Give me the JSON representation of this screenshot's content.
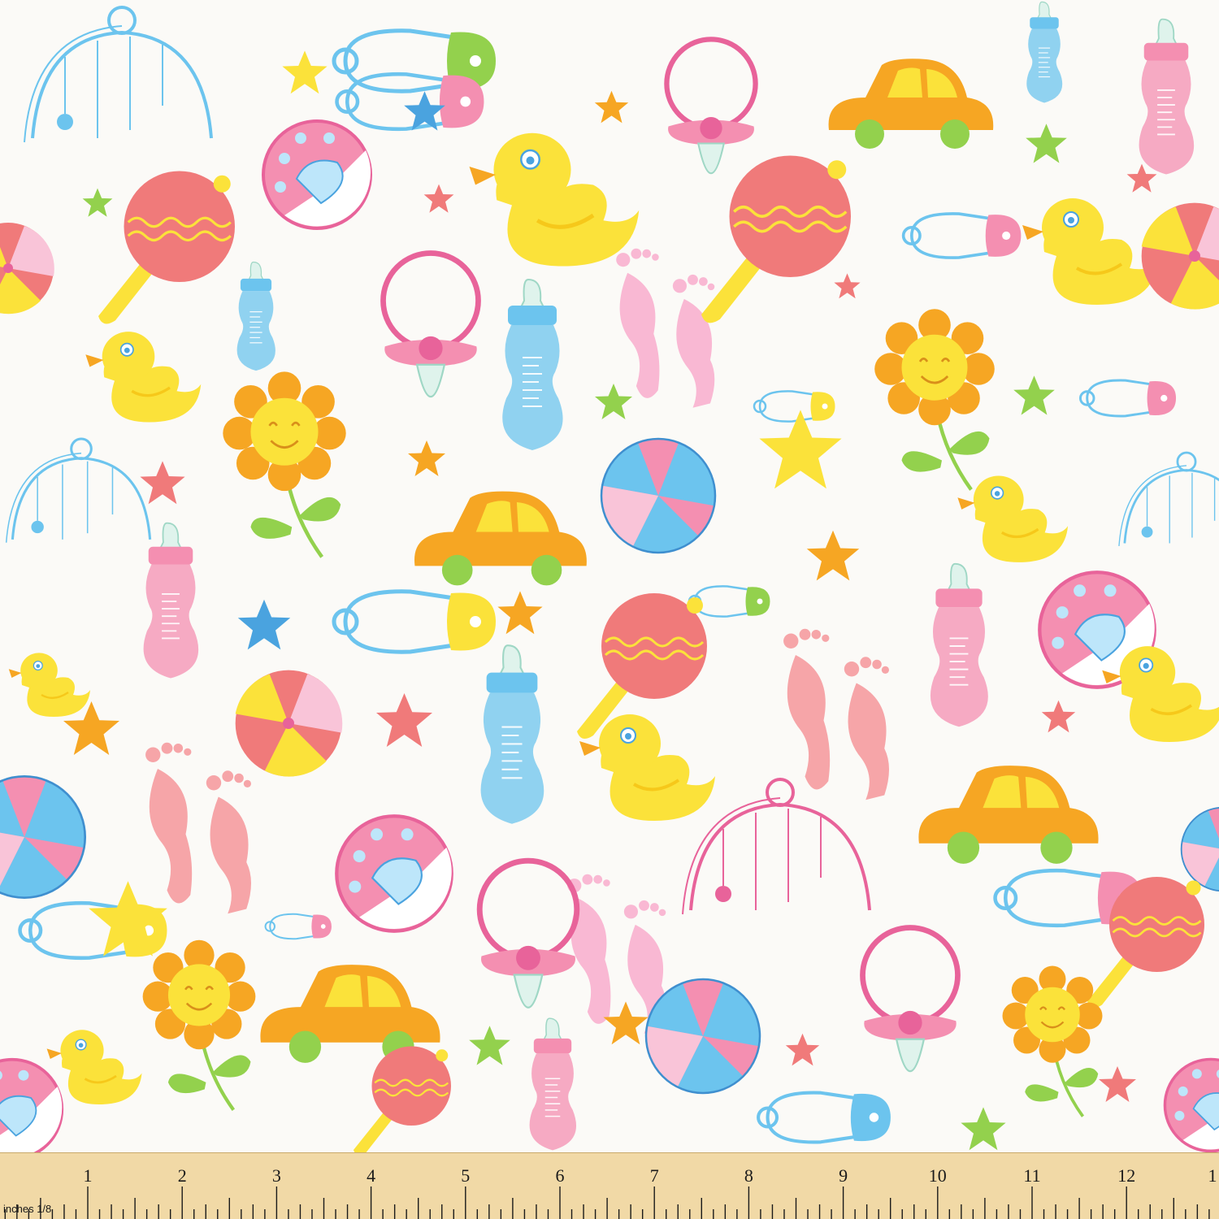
{
  "ruler": {
    "unit_label": "inches 1/8",
    "numbers": [
      "1",
      "2",
      "3",
      "4",
      "5",
      "6",
      "7",
      "8",
      "9",
      "10",
      "11",
      "12",
      "1"
    ]
  },
  "colors": {
    "background": "#fbfaf7",
    "pink": "#f48fb1",
    "hot_pink": "#e8639a",
    "coral": "#f07a7a",
    "yellow": "#fbe23a",
    "orange": "#f6a623",
    "blue": "#6cc4ee",
    "sky": "#4aa3df",
    "green": "#93d14d",
    "ruler_wood": "#f1d9a6",
    "ruler_ink": "#1a1a1a"
  },
  "motifs": [
    "rubber-duck-icon",
    "baby-bottle-icon",
    "beach-ball-icon",
    "safety-pin-icon",
    "pacifier-icon",
    "baby-rattle-icon",
    "toy-car-icon",
    "smiling-flower-icon",
    "footprints-icon",
    "star-icon",
    "crib-mobile-icon",
    "seashell-ball-icon"
  ]
}
